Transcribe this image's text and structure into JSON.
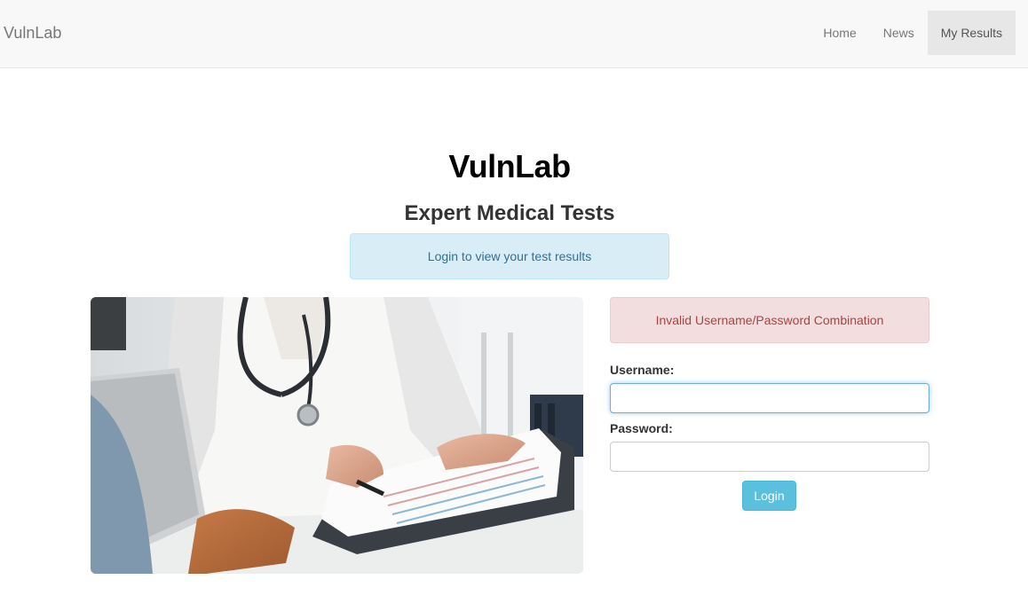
{
  "navbar": {
    "brand": "VulnLab",
    "items": [
      {
        "label": "Home",
        "active": false
      },
      {
        "label": "News",
        "active": false
      },
      {
        "label": "My Results",
        "active": true
      }
    ]
  },
  "header": {
    "title": "VulnLab",
    "subtitle": "Expert Medical Tests"
  },
  "alerts": {
    "info": "Login to view your test results",
    "error": "Invalid Username/Password Combination"
  },
  "form": {
    "username_label": "Username:",
    "username_value": "",
    "password_label": "Password:",
    "password_value": "",
    "login_label": "Login"
  },
  "colors": {
    "info_bg": "#d9edf7",
    "info_text": "#31708f",
    "error_bg": "#f2dede",
    "error_text": "#a94442",
    "button": "#5bc0de",
    "focus": "#66afe9"
  },
  "photo": {
    "icon": "doctor-with-clipboard-photo"
  }
}
